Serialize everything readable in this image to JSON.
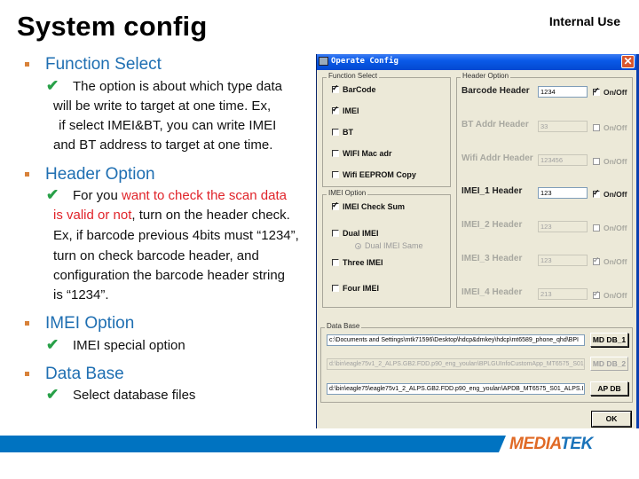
{
  "page": {
    "title": "System config",
    "classification": "Internal Use"
  },
  "sections": [
    {
      "title": "Function Select",
      "lines": [
        "The option is about which type data",
        "will be write to target at one time. Ex,",
        " if select IMEI&BT, you can write IMEI",
        "and BT address to target at one time."
      ]
    },
    {
      "title": "Header Option",
      "line1_prefix": "For you ",
      "line1_highlight": "want to check the scan data",
      "line2_highlight": "is valid or not",
      "line2_rest": ", turn on the header check.",
      "lines": [
        "Ex, if barcode previous 4bits must “1234”,",
        "turn on check barcode header, and",
        "configuration the barcode header string",
        "is “1234”."
      ]
    },
    {
      "title": "IMEI Option",
      "lines": [
        "IMEI special option"
      ]
    },
    {
      "title": "Data Base",
      "lines": [
        "Select database files"
      ]
    }
  ],
  "colors": {
    "section_title": "#1f6fb2",
    "highlight": "#e0242a",
    "check": "#28a048",
    "bullet": "#d8823a",
    "footer_bar": "#0073c1",
    "brand_orange": "#e06a26",
    "brand_blue": "#1a73ba"
  },
  "dialog": {
    "title": "Operate Config",
    "close_icon": "close-icon",
    "function_select": {
      "label": "Function Select",
      "items": [
        {
          "label": "BarCode",
          "checked": true
        },
        {
          "label": "IMEI",
          "checked": true
        },
        {
          "label": "BT",
          "checked": false
        },
        {
          "label": "WIFI Mac adr",
          "checked": false
        },
        {
          "label": "Wifi EEPROM Copy",
          "checked": false
        }
      ]
    },
    "imei_option": {
      "label": "IMEI Option",
      "items": [
        {
          "label": "IMEI Check Sum",
          "checked": true
        },
        {
          "label": "Dual IMEI",
          "checked": false
        },
        {
          "label": "Three IMEI",
          "checked": false
        },
        {
          "label": "Four IMEI",
          "checked": false
        }
      ],
      "radio": {
        "label": "Dual IMEI Same",
        "selected": false,
        "enabled": false
      }
    },
    "header_option": {
      "label": "Header Option",
      "onoff_label": "On/Off",
      "rows": [
        {
          "label": "Barcode Header",
          "value": "1234",
          "on": true,
          "enabled": true
        },
        {
          "label": "BT Addr Header",
          "value": "33",
          "on": false,
          "enabled": false
        },
        {
          "label": "Wifi Addr Header",
          "value": "123456",
          "on": false,
          "enabled": false
        },
        {
          "label": "IMEI_1 Header",
          "value": "123",
          "on": true,
          "enabled": true
        },
        {
          "label": "IMEI_2 Header",
          "value": "123",
          "on": false,
          "enabled": false
        },
        {
          "label": "IMEI_3 Header",
          "value": "123",
          "on": true,
          "enabled": false
        },
        {
          "label": "IMEI_4 Header",
          "value": "213",
          "on": true,
          "enabled": false
        }
      ]
    },
    "database": {
      "label": "Data Base",
      "rows": [
        {
          "path": "c:\\Documents and Settings\\mtk71596\\Desktop\\hdcp&dmkey\\hdcp\\mt6589_phone_qhd\\BPI",
          "button": "MD DB_1",
          "enabled": true
        },
        {
          "path": "d:\\bin\\eagle75v1_2_ALPS.GB2.FDD.p90_eng_youlan\\BPLGUInfoCustomApp_MT6575_S01_",
          "button": "MD DB_2",
          "enabled": false
        },
        {
          "path": "d:\\bin\\eagle75\\eagle75v1_2_ALPS.GB2.FDD.p90_eng_youlan\\APDB_MT6575_S01_ALPS.I",
          "button": "AP DB",
          "enabled": true
        }
      ]
    },
    "ok_label": "OK"
  },
  "footer": {
    "brand_part1": "MEDIA",
    "brand_part2": "TEK"
  }
}
